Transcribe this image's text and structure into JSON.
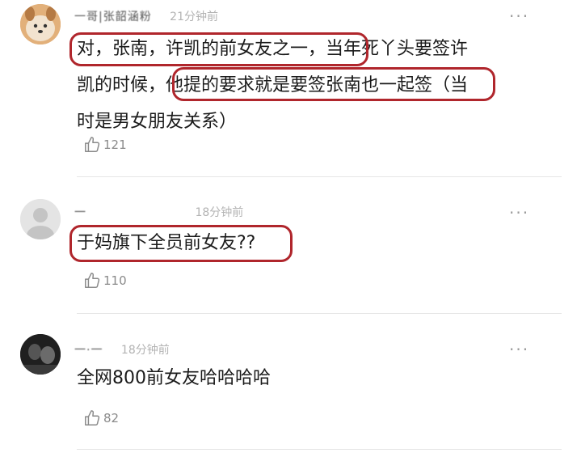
{
  "comments": [
    {
      "username": "一哥|张韶涵粉",
      "time": "21分钟前",
      "more": "···",
      "lines": [
        "对，张南，许凯的前女友之一，当年死丫头要签许",
        "凯的时候，他提的要求就是要签张南也一起签（当",
        "时是男女朋友关系）"
      ],
      "likes": "121"
    },
    {
      "username": "一",
      "time": "18分钟前",
      "more": "···",
      "lines": [
        "于妈旗下全员前女友??"
      ],
      "likes": "110"
    },
    {
      "username": "一·一",
      "time": "18分钟前",
      "more": "···",
      "lines": [
        "全网800前女友哈哈哈哈"
      ],
      "likes": "82"
    }
  ]
}
